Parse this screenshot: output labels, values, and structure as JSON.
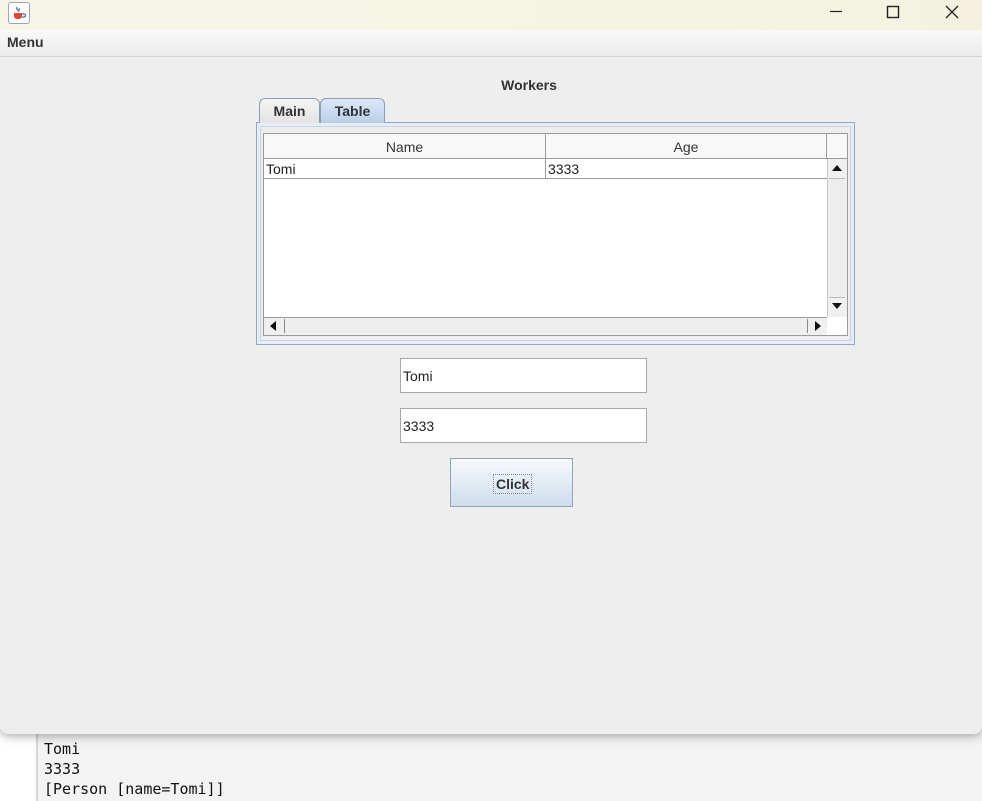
{
  "window": {
    "icon": "java-cup-icon",
    "controls": [
      "minimize-icon",
      "maximize-icon",
      "close-icon"
    ]
  },
  "menubar": {
    "menu_label": "Menu"
  },
  "panel": {
    "title": "Workers"
  },
  "tabs": [
    {
      "label": "Main",
      "selected": false
    },
    {
      "label": "Table",
      "selected": true
    }
  ],
  "table": {
    "columns": [
      "Name",
      "Age"
    ],
    "rows": [
      {
        "name": "Tomi",
        "age": "3333"
      }
    ]
  },
  "form": {
    "name_value": "Tomi",
    "age_value": "3333",
    "button_label": "Click"
  },
  "console": {
    "lines": [
      "Tomi",
      "3333",
      "[Person [name=Tomi]]"
    ]
  },
  "colors": {
    "tab_selected": "#b8cfea",
    "panel_border": "#8ea9cc",
    "button_gradient_end": "#cfdcec"
  }
}
